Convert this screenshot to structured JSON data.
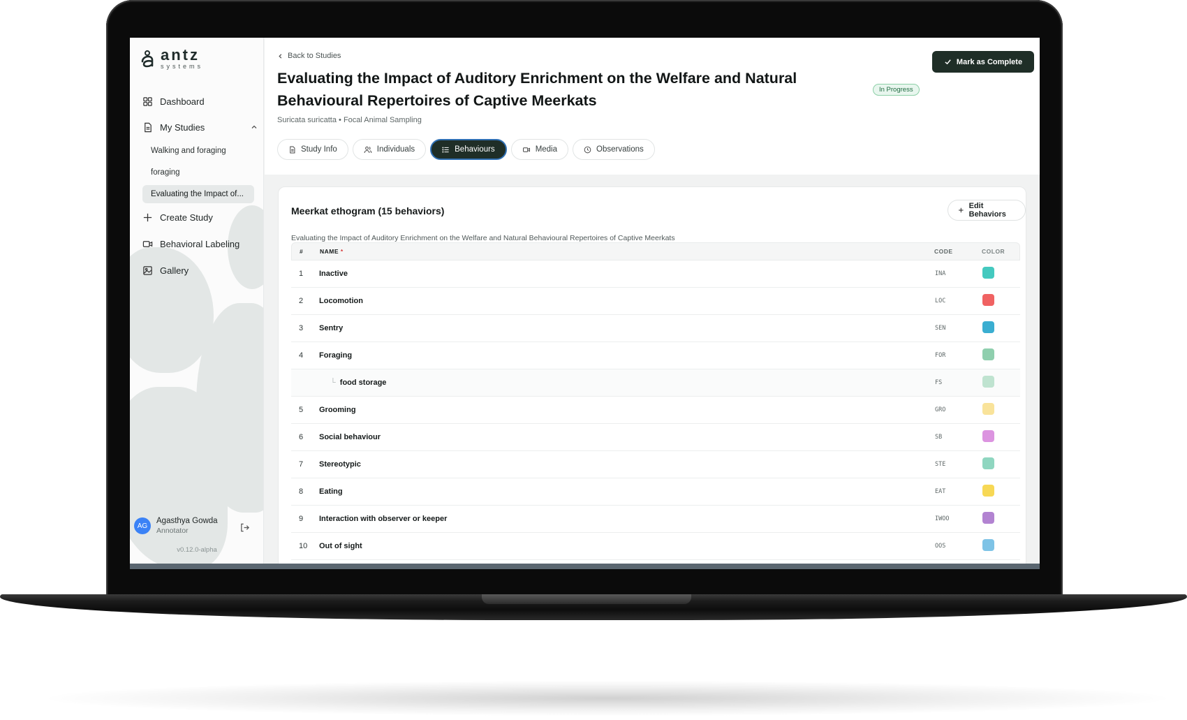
{
  "brand": {
    "name": "antz",
    "tagline": "systems"
  },
  "sidebar": {
    "items": [
      {
        "label": "Dashboard"
      },
      {
        "label": "My Studies"
      },
      {
        "label": "Create Study"
      },
      {
        "label": "Behavioral Labeling"
      },
      {
        "label": "Gallery"
      }
    ],
    "studies": [
      {
        "label": "Walking and foraging"
      },
      {
        "label": "foraging"
      },
      {
        "label": "Evaluating the Impact of..."
      }
    ],
    "user": {
      "initials": "AG",
      "name": "Agasthya Gowda",
      "role": "Annotator"
    },
    "version": "v0.12.0-alpha"
  },
  "header": {
    "back_label": "Back to Studies",
    "title": "Evaluating the Impact of Auditory Enrichment on the Welfare and Natural Behavioural Repertoires of Captive Meerkats",
    "subtitle": "Suricata suricatta • Focal Animal Sampling",
    "status": "In Progress",
    "complete_label": "Mark as Complete"
  },
  "tabs": [
    {
      "label": "Study Info"
    },
    {
      "label": "Individuals"
    },
    {
      "label": "Behaviours"
    },
    {
      "label": "Media"
    },
    {
      "label": "Observations"
    }
  ],
  "ethogram": {
    "title": "Meerkat ethogram (15 behaviors)",
    "edit_label": "Edit Behaviors",
    "description": "Evaluating the Impact of Auditory Enrichment on the Welfare and Natural Behavioural Repertoires of Captive Meerkats",
    "columns": {
      "num": "#",
      "name": "NAME",
      "required": "*",
      "code": "CODE",
      "color": "COLOR"
    },
    "rows": [
      {
        "num": "1",
        "name": "Inactive",
        "code": "INA",
        "color": "#44c9bf"
      },
      {
        "num": "2",
        "name": "Locomotion",
        "code": "LOC",
        "color": "#f06262"
      },
      {
        "num": "3",
        "name": "Sentry",
        "code": "SEN",
        "color": "#3aaed1"
      },
      {
        "num": "4",
        "name": "Foraging",
        "code": "FOR",
        "color": "#8fcfae"
      },
      {
        "num": "",
        "name": "food storage",
        "code": "FS",
        "color": "#bfe3d0"
      },
      {
        "num": "5",
        "name": "Grooming",
        "code": "GRO",
        "color": "#f9e39a"
      },
      {
        "num": "6",
        "name": "Social behaviour",
        "code": "SB",
        "color": "#dc94e0"
      },
      {
        "num": "7",
        "name": "Stereotypic",
        "code": "STE",
        "color": "#8fd6c0"
      },
      {
        "num": "8",
        "name": "Eating",
        "code": "EAT",
        "color": "#f7d855"
      },
      {
        "num": "9",
        "name": "Interaction with observer or keeper",
        "code": "IWOO",
        "color": "#b283d1"
      },
      {
        "num": "10",
        "name": "Out of sight",
        "code": "OOS",
        "color": "#7ec3e6"
      }
    ]
  }
}
